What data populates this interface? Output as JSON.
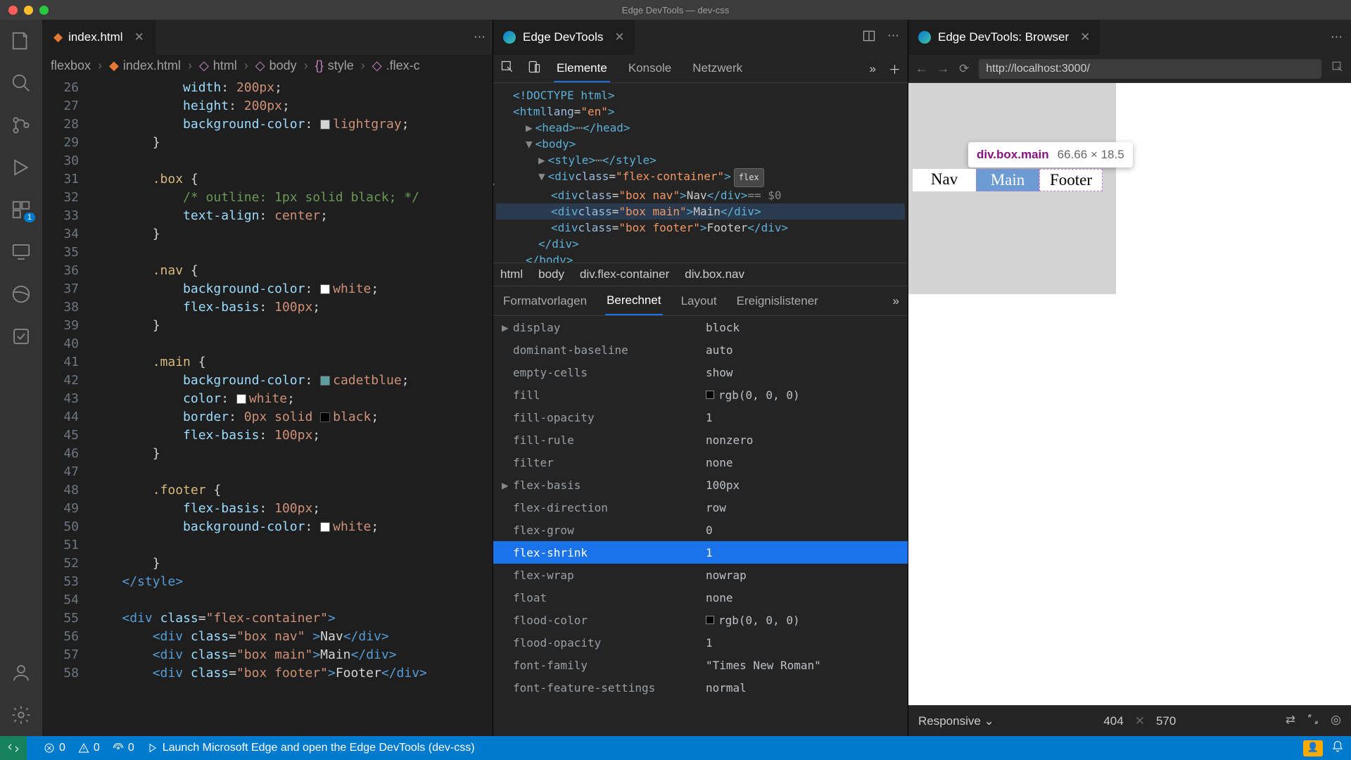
{
  "window": {
    "title": "Edge DevTools — dev-css"
  },
  "editor": {
    "tab_label": "index.html",
    "breadcrumb": [
      "flexbox",
      "index.html",
      "html",
      "body",
      "style",
      ".flex-c"
    ],
    "lines": [
      {
        "n": 26,
        "html": "            <span class='p'>width</span><span class='w'>: </span><span class='s'>200px</span><span class='w'>;</span>"
      },
      {
        "n": 27,
        "html": "            <span class='p'>height</span><span class='w'>: </span><span class='s'>200px</span><span class='w'>;</span>"
      },
      {
        "n": 28,
        "html": "            <span class='p'>background-color</span><span class='w'>: </span><span class='swatch' style='background:#d3d3d3'></span><span class='s'>lightgray</span><span class='w'>;</span>"
      },
      {
        "n": 29,
        "html": "        <span class='w'>}</span>"
      },
      {
        "n": 30,
        "html": ""
      },
      {
        "n": 31,
        "html": "        <span class='y'>.box</span> <span class='w'>{</span>"
      },
      {
        "n": 32,
        "html": "            <span class='c'>/* outline: 1px solid black; */</span>"
      },
      {
        "n": 33,
        "html": "            <span class='p'>text-align</span><span class='w'>: </span><span class='s'>center</span><span class='w'>;</span>"
      },
      {
        "n": 34,
        "html": "        <span class='w'>}</span>"
      },
      {
        "n": 35,
        "html": ""
      },
      {
        "n": 36,
        "html": "        <span class='y'>.nav</span> <span class='w'>{</span>"
      },
      {
        "n": 37,
        "html": "            <span class='p'>background-color</span><span class='w'>: </span><span class='swatch' style='background:#fff'></span><span class='s'>white</span><span class='w'>;</span>"
      },
      {
        "n": 38,
        "html": "            <span class='p'>flex-basis</span><span class='w'>: </span><span class='s'>100px</span><span class='w'>;</span>"
      },
      {
        "n": 39,
        "html": "        <span class='w'>}</span>"
      },
      {
        "n": 40,
        "html": ""
      },
      {
        "n": 41,
        "html": "        <span class='y'>.main</span> <span class='w'>{</span>"
      },
      {
        "n": 42,
        "html": "            <span class='p'>background-color</span><span class='w'>: </span><span class='swatch' style='background:#5f9ea0'></span><span class='s'>cadetblue</span><span class='w'>;</span>"
      },
      {
        "n": 43,
        "html": "            <span class='p'>color</span><span class='w'>: </span><span class='swatch' style='background:#fff'></span><span class='s'>white</span><span class='w'>;</span>"
      },
      {
        "n": 44,
        "html": "            <span class='p'>border</span><span class='w'>: </span><span class='s'>0px</span> <span class='s'>solid</span> <span class='swatch' style='background:#000'></span><span class='s'>black</span><span class='w'>;</span>"
      },
      {
        "n": 45,
        "html": "            <span class='p'>flex-basis</span><span class='w'>: </span><span class='s'>100px</span><span class='w'>;</span>"
      },
      {
        "n": 46,
        "html": "        <span class='w'>}</span>"
      },
      {
        "n": 47,
        "html": ""
      },
      {
        "n": 48,
        "html": "        <span class='y'>.footer</span> <span class='w'>{</span>"
      },
      {
        "n": 49,
        "html": "            <span class='p'>flex-basis</span><span class='w'>: </span><span class='s'>100px</span><span class='w'>;</span>"
      },
      {
        "n": 50,
        "html": "            <span class='p'>background-color</span><span class='w'>: </span><span class='swatch' style='background:#fff'></span><span class='s'>white</span><span class='w'>;</span>"
      },
      {
        "n": 51,
        "html": ""
      },
      {
        "n": 52,
        "html": "        <span class='w'>}</span>"
      },
      {
        "n": 53,
        "html": "    <span class='t'>&lt;/style&gt;</span>"
      },
      {
        "n": 54,
        "html": ""
      },
      {
        "n": 55,
        "html": "    <span class='t'>&lt;div</span> <span class='p'>class</span><span class='w'>=</span><span class='s'>\"flex-container\"</span><span class='t'>&gt;</span>"
      },
      {
        "n": 56,
        "html": "        <span class='t'>&lt;div</span> <span class='p'>class</span><span class='w'>=</span><span class='s'>\"box nav\"</span> <span class='t'>&gt;</span><span class='w'>Nav</span><span class='t'>&lt;/div&gt;</span>"
      },
      {
        "n": 57,
        "html": "        <span class='t'>&lt;div</span> <span class='p'>class</span><span class='w'>=</span><span class='s'>\"box main\"</span><span class='t'>&gt;</span><span class='w'>Main</span><span class='t'>&lt;/div&gt;</span>"
      },
      {
        "n": 58,
        "html": "        <span class='t'>&lt;div</span> <span class='p'>class</span><span class='w'>=</span><span class='s'>\"box footer\"</span><span class='t'>&gt;</span><span class='w'>Footer</span><span class='t'>&lt;/div&gt;</span>"
      }
    ]
  },
  "devtools": {
    "tab_label": "Edge DevTools",
    "toolbar_tabs": [
      "Elemente",
      "Konsole",
      "Netzwerk"
    ],
    "active_toolbar": "Elemente",
    "dom_crumb": [
      "html",
      "body",
      "div.flex-container",
      "div.box.nav"
    ],
    "side_tabs": [
      "Formatvorlagen",
      "Berechnet",
      "Layout",
      "Ereignislistener"
    ],
    "active_side": "Berechnet",
    "dom_rows": [
      {
        "indent": 1,
        "html": "<span class='tg'>&lt;!DOCTYPE html&gt;</span>"
      },
      {
        "indent": 1,
        "html": "<span class='tg'>&lt;html</span> <span class='at'>lang</span>=<span class='av'>\"en\"</span><span class='tg'>&gt;</span>"
      },
      {
        "indent": 2,
        "html": "<span class='arrow'>▶</span><span class='tg'>&lt;head&gt;</span> <span class='dots'>⋯</span> <span class='tg'>&lt;/head&gt;</span>"
      },
      {
        "indent": 2,
        "html": "<span class='arrow'>▼</span><span class='tg'>&lt;body&gt;</span>"
      },
      {
        "indent": 3,
        "html": "<span class='arrow'>▶</span><span class='tg'>&lt;style&gt;</span> <span class='dots'>⋯</span> <span class='tg'>&lt;/style&gt;</span>"
      },
      {
        "indent": 3,
        "html": "<span class='arrow'>▼</span><span class='tg'>&lt;div</span> <span class='at'>class</span>=<span class='av'>\"flex-container\"</span><span class='tg'>&gt;</span> <span class='flex-badge'>flex</span>"
      },
      {
        "indent": 4,
        "html": "<span class='tg'>&lt;div</span> <span class='at'>class</span>=<span class='av'>\"box nav\"</span><span class='tg'>&gt;</span><span class='tx'>Nav</span><span class='tg'>&lt;/div&gt;</span> <span class='sel'>== $0</span>"
      },
      {
        "indent": 4,
        "hover": true,
        "html": "<span class='tg'>&lt;div</span> <span class='at'>class</span>=<span class='av'>\"box main\"</span><span class='tg'>&gt;</span><span class='tx'>Main</span><span class='tg'>&lt;/div&gt;</span>"
      },
      {
        "indent": 4,
        "html": "<span class='tg'>&lt;div</span> <span class='at'>class</span>=<span class='av'>\"box footer\"</span><span class='tg'>&gt;</span><span class='tx'>Footer</span><span class='tg'>&lt;/div&gt;</span>"
      },
      {
        "indent": 3,
        "html": "<span class='tg'>&lt;/div&gt;</span>"
      },
      {
        "indent": 2,
        "html": "<span class='tg'>&lt;/body&gt;</span>"
      }
    ],
    "computed": [
      {
        "name": "display",
        "value": "block",
        "arrow": true
      },
      {
        "name": "dominant-baseline",
        "value": "auto"
      },
      {
        "name": "empty-cells",
        "value": "show"
      },
      {
        "name": "fill",
        "value": "rgb(0, 0, 0)",
        "swatch": "#000"
      },
      {
        "name": "fill-opacity",
        "value": "1"
      },
      {
        "name": "fill-rule",
        "value": "nonzero"
      },
      {
        "name": "filter",
        "value": "none"
      },
      {
        "name": "flex-basis",
        "value": "100px",
        "arrow": true
      },
      {
        "name": "flex-direction",
        "value": "row"
      },
      {
        "name": "flex-grow",
        "value": "0"
      },
      {
        "name": "flex-shrink",
        "value": "1",
        "highlight": true
      },
      {
        "name": "flex-wrap",
        "value": "nowrap"
      },
      {
        "name": "float",
        "value": "none"
      },
      {
        "name": "flood-color",
        "value": "rgb(0, 0, 0)",
        "swatch": "#000"
      },
      {
        "name": "flood-opacity",
        "value": "1"
      },
      {
        "name": "font-family",
        "value": "\"Times New Roman\""
      },
      {
        "name": "font-feature-settings",
        "value": "normal"
      }
    ]
  },
  "browser": {
    "tab_label": "Edge DevTools: Browser",
    "url": "http://localhost:3000/",
    "tooltip_selector": "div.box.main",
    "tooltip_dims": "66.66 × 18.5",
    "boxes": [
      "Nav",
      "Main",
      "Footer"
    ],
    "responsive_label": "Responsive",
    "vp_w": "404",
    "vp_h": "570"
  },
  "status": {
    "errors": "0",
    "warnings": "0",
    "ports": "0",
    "launch": "Launch Microsoft Edge and open the Edge DevTools (dev-css)"
  }
}
